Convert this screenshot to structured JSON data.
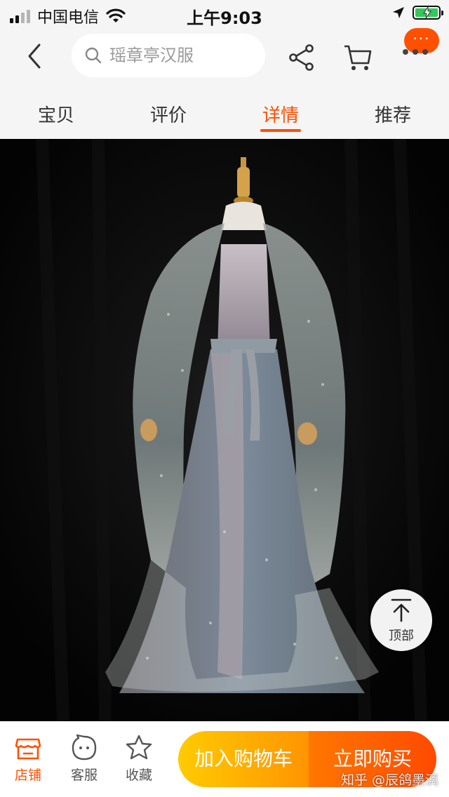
{
  "status_bar": {
    "carrier": "中国电信",
    "time": "上午9:03"
  },
  "nav": {
    "search_placeholder": "瑶章亭汉服",
    "more_badge": "···"
  },
  "tabs": [
    {
      "label": "宝贝",
      "active": false
    },
    {
      "label": "评价",
      "active": false
    },
    {
      "label": "详情",
      "active": true
    },
    {
      "label": "推荐",
      "active": false
    }
  ],
  "scroll_top_button": {
    "label": "顶部"
  },
  "bottom_bar": {
    "store_label": "店铺",
    "service_label": "客服",
    "favorite_label": "收藏",
    "add_to_cart_label": "加入购物车",
    "buy_now_label": "立即购买"
  },
  "watermark": "知乎 @辰鸽墨漓",
  "colors": {
    "accent": "#ff5000",
    "cart_gradient": [
      "#ffcb00",
      "#ff9402"
    ],
    "buy_gradient": [
      "#ff7700",
      "#ff4a00"
    ]
  }
}
